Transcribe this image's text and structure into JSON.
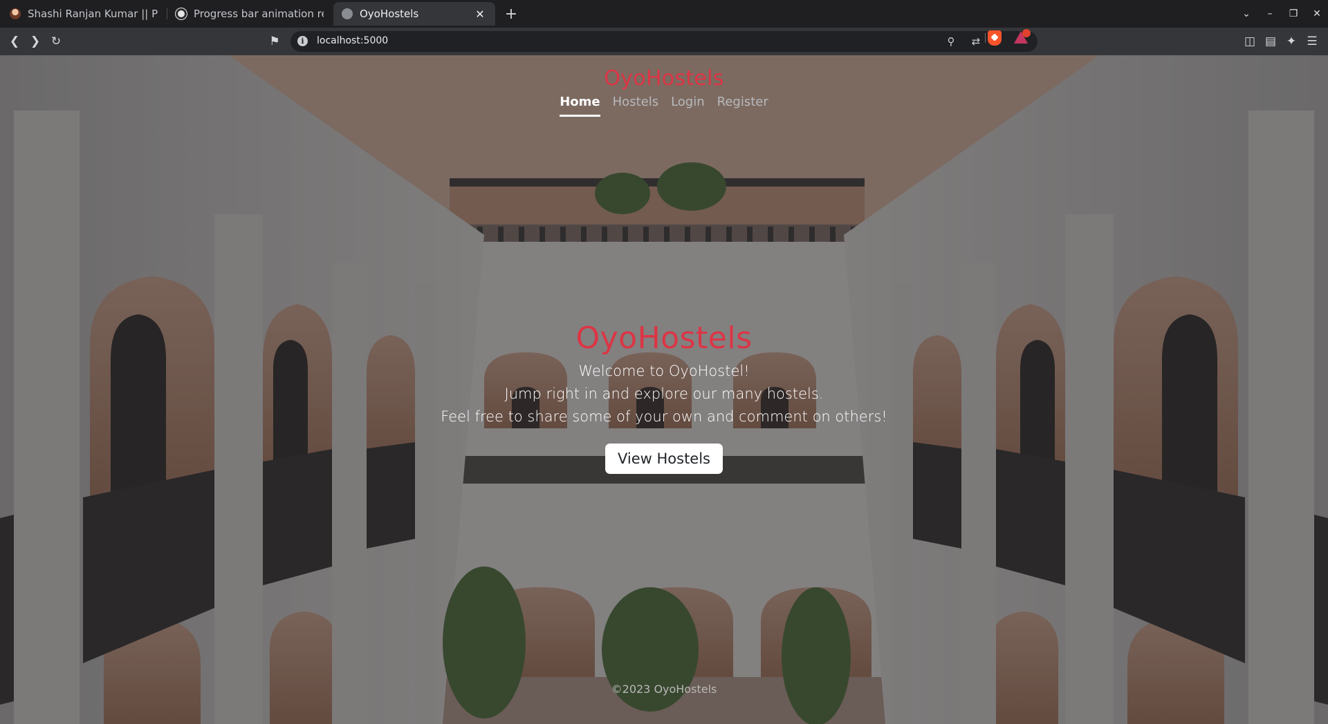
{
  "browser": {
    "tabs": [
      {
        "title": "Shashi Ranjan Kumar || Perso",
        "active": false
      },
      {
        "title": "Progress bar animation revie",
        "active": false
      },
      {
        "title": "OyoHostels",
        "active": true
      }
    ],
    "address": "localhost:5000",
    "icons": {
      "back": "back-arrow-icon",
      "forward": "forward-arrow-icon",
      "reload": "reload-icon",
      "bookmark": "bookmark-icon",
      "zoom": "zoom-icon",
      "share": "share-icon",
      "shields": "brave-shields-icon",
      "rewards": "brave-rewards-icon",
      "sidebar": "sidebar-icon",
      "wallet": "wallet-icon",
      "leo": "leo-ai-icon",
      "menu": "menu-icon"
    }
  },
  "site": {
    "brand": "OyoHostels",
    "nav": [
      {
        "label": "Home",
        "active": true
      },
      {
        "label": "Hostels",
        "active": false
      },
      {
        "label": "Login",
        "active": false
      },
      {
        "label": "Register",
        "active": false
      }
    ],
    "hero": {
      "title": "OyoHostels",
      "lines": [
        "Welcome to OyoHostel!",
        "Jump right in and explore our many hostels.",
        "Feel free to share some of your own and comment on others!"
      ],
      "button": "View Hostels"
    },
    "footer": "©2023 OyoHostels",
    "colors": {
      "brand": "#dc3545",
      "button_bg": "#ffffff",
      "nav_active": "#ffffff",
      "nav_inactive": "#b8b9bb"
    }
  }
}
